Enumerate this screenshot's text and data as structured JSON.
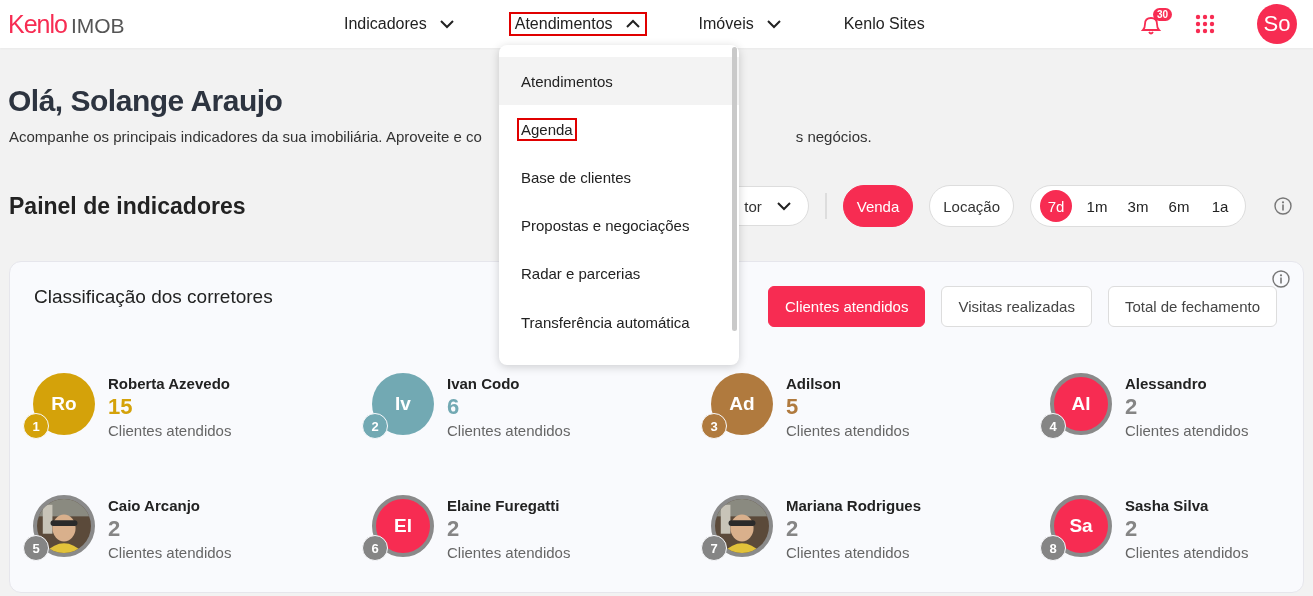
{
  "header": {
    "logo": {
      "brand": "Kenlo",
      "product": "IMOB"
    },
    "nav": [
      {
        "label": "Indicadores",
        "kind": "dropdown",
        "highlighted": false
      },
      {
        "label": "Atendimentos",
        "kind": "open-dropdown",
        "highlighted": true
      },
      {
        "label": "Imóveis",
        "kind": "dropdown",
        "highlighted": false
      },
      {
        "label": "Kenlo Sites",
        "kind": "link",
        "highlighted": false
      }
    ],
    "notifications": {
      "count": "30"
    },
    "user": {
      "initials": "So"
    }
  },
  "menu": {
    "items": [
      {
        "label": "Atendimentos",
        "hovered": true,
        "highlighted": false
      },
      {
        "label": "Agenda",
        "hovered": false,
        "highlighted": true
      },
      {
        "label": "Base de clientes",
        "hovered": false,
        "highlighted": false
      },
      {
        "label": "Propostas e negociações",
        "hovered": false,
        "highlighted": false
      },
      {
        "label": "Radar e parcerias",
        "hovered": false,
        "highlighted": false
      },
      {
        "label": "Transferência automática",
        "hovered": false,
        "highlighted": false
      }
    ]
  },
  "greeting": "Olá, Solange Araujo",
  "subtitle_parts": [
    "Acompanhe os principais indicadores da sua imobiliária. Aproveite e co",
    "s negócios."
  ],
  "panel": {
    "title": "Painel de indicadores",
    "filter": {
      "label": "tor"
    },
    "deal_types": [
      {
        "label": "Venda",
        "selected": true
      },
      {
        "label": "Locação",
        "selected": false
      }
    ],
    "periods": [
      {
        "label": "7d",
        "selected": true
      },
      {
        "label": "1m",
        "selected": false
      },
      {
        "label": "3m",
        "selected": false
      },
      {
        "label": "6m",
        "selected": false
      },
      {
        "label": "1a",
        "selected": false
      }
    ]
  },
  "ranking": {
    "title": "Classificação dos corretores",
    "tabs": [
      {
        "label": "Clientes atendidos",
        "selected": true
      },
      {
        "label": "Visitas realizadas",
        "selected": false
      },
      {
        "label": "Total de fechamento",
        "selected": false
      }
    ],
    "brokers": [
      {
        "rank": "1",
        "name": "Roberta Azevedo",
        "count": "15",
        "label": "Clientes atendidos",
        "color": "#d4a20a",
        "avatar": {
          "kind": "initials",
          "initials": "Ro",
          "color": "#d4a20a",
          "ring": false
        }
      },
      {
        "rank": "2",
        "name": "Ivan Codo",
        "count": "6",
        "label": "Clientes atendidos",
        "color": "#72a9b3",
        "avatar": {
          "kind": "initials",
          "initials": "Iv",
          "color": "#72a9b3",
          "ring": false
        }
      },
      {
        "rank": "3",
        "name": "Adilson",
        "count": "5",
        "label": "Clientes atendidos",
        "color": "#b07a3e",
        "avatar": {
          "kind": "initials",
          "initials": "Ad",
          "color": "#b07a3e",
          "ring": false
        }
      },
      {
        "rank": "4",
        "name": "Alessandro",
        "count": "2",
        "label": "Clientes atendidos",
        "color": "#858585",
        "avatar": {
          "kind": "initials",
          "initials": "Al",
          "color": "#f72c52",
          "ring": true
        }
      },
      {
        "rank": "5",
        "name": "Caio Arcanjo",
        "count": "2",
        "label": "Clientes atendidos",
        "color": "#858585",
        "avatar": {
          "kind": "picture",
          "ring": true
        }
      },
      {
        "rank": "6",
        "name": "Elaine Furegatti",
        "count": "2",
        "label": "Clientes atendidos",
        "color": "#858585",
        "avatar": {
          "kind": "initials",
          "initials": "El",
          "color": "#f72c52",
          "ring": true
        }
      },
      {
        "rank": "7",
        "name": "Mariana Rodrigues",
        "count": "2",
        "label": "Clientes atendidos",
        "color": "#858585",
        "avatar": {
          "kind": "picture",
          "ring": true
        }
      },
      {
        "rank": "8",
        "name": "Sasha Silva",
        "count": "2",
        "label": "Clientes atendidos",
        "color": "#858585",
        "avatar": {
          "kind": "initials",
          "initials": "Sa",
          "color": "#f72c52",
          "ring": true
        }
      }
    ]
  }
}
